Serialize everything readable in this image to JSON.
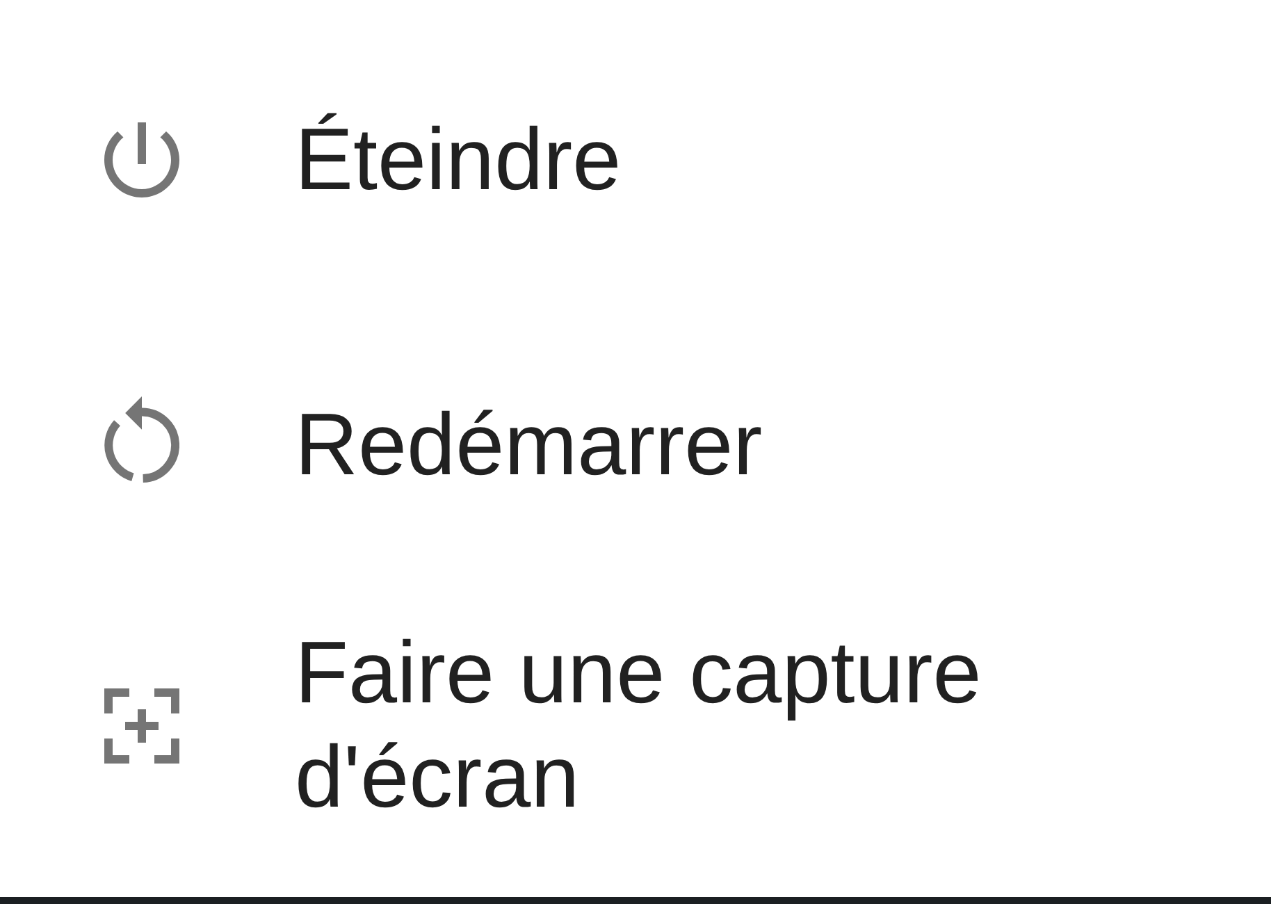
{
  "menu": {
    "items": [
      {
        "kind": "power",
        "label": "Éteindre"
      },
      {
        "kind": "restart",
        "label": "Redémarrer"
      },
      {
        "kind": "screenshot",
        "label": "Faire une capture d'écran"
      }
    ]
  }
}
